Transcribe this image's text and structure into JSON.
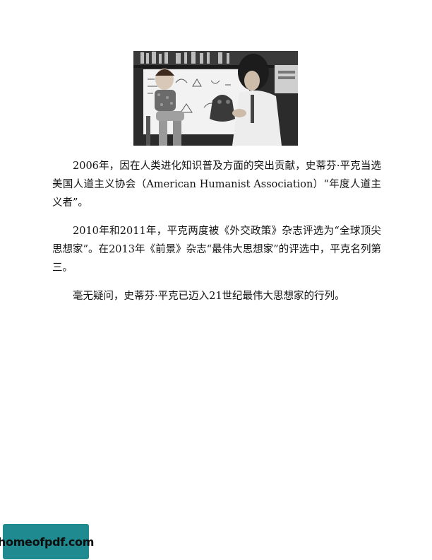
{
  "document": {
    "paragraphs": [
      "2006年，因在人类进化知识普及方面的突出贡献，史蒂芬·平克当选美国人道主义协会（American Humanist Association）“年度人道主义者”。",
      "2010年和2011年，平克两度被《外交政策》杂志评选为“全球顶尖思想家”。在2013年《前景》杂志“最伟大思想家”的评选中，平克名列第三。",
      "毫无疑问，史蒂芬·平克已迈入21世纪最伟大思想家的行列。"
    ]
  },
  "watermark": {
    "text": "homeofpdf.com",
    "color": "#1f8a8f"
  }
}
